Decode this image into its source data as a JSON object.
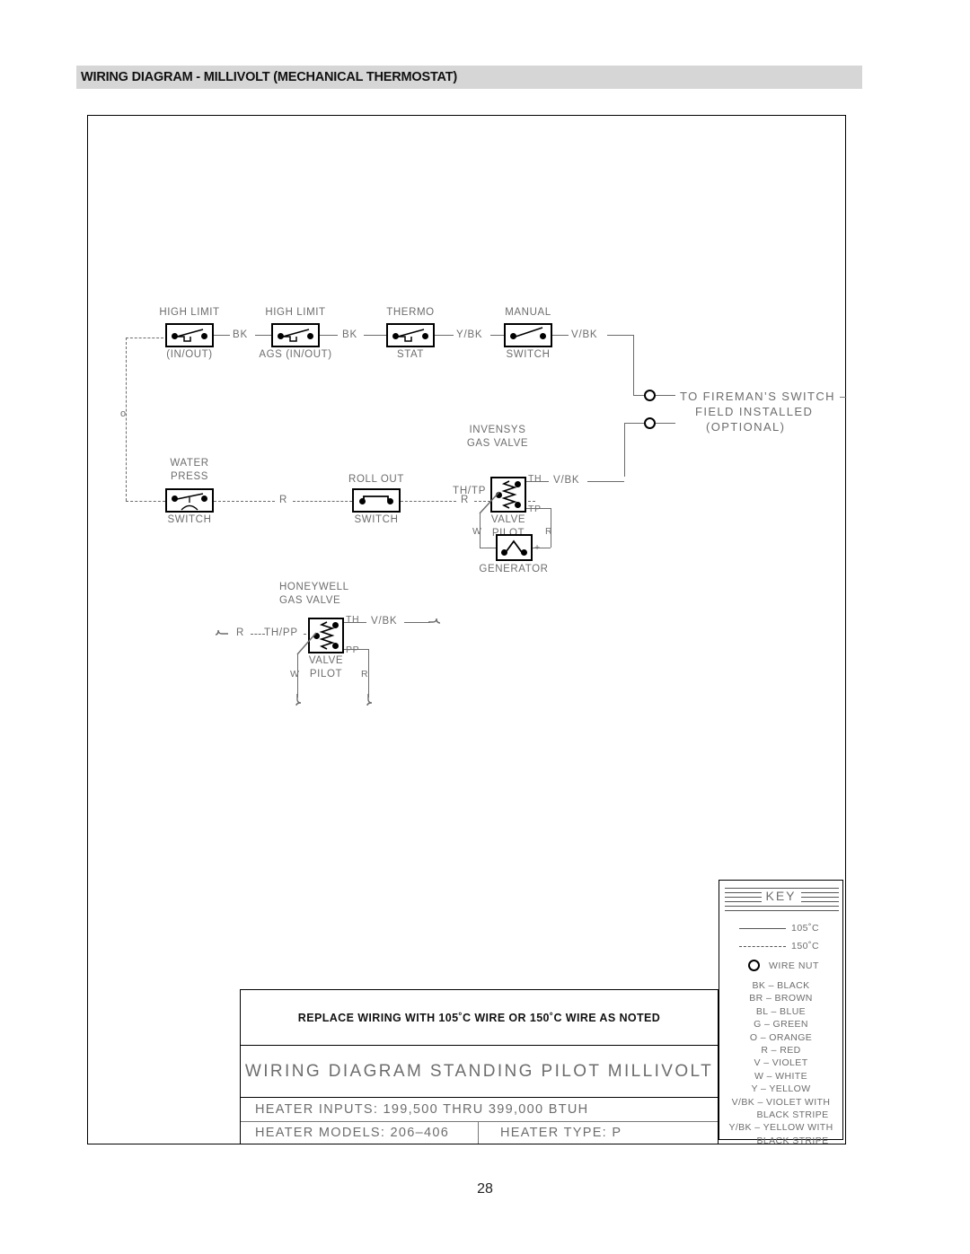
{
  "header": {
    "title": "WIRING DIAGRAM - MILLIVOLT (MECHANICAL THERMOSTAT)"
  },
  "page": {
    "number": "28"
  },
  "diagram": {
    "components": {
      "high_limit_in_out": {
        "top": "HIGH  LIMIT",
        "bottom": "(IN/OUT)"
      },
      "high_limit_ags": {
        "top": "HIGH  LIMIT",
        "bottom": "AGS  (IN/OUT)"
      },
      "thermostat": {
        "top": "THERMO",
        "bottom": "STAT"
      },
      "manual_switch": {
        "top": "MANUAL",
        "bottom": "SWITCH"
      },
      "water_press_switch": {
        "top1": "WATER",
        "top2": "PRESS",
        "bottom": "SWITCH"
      },
      "roll_out_switch": {
        "top": "ROLL  OUT",
        "bottom": "SWITCH"
      },
      "invensys_valve": {
        "title1": "INVENSYS",
        "title2": "GAS  VALVE",
        "body1": "VALVE",
        "body2": "PILOT"
      },
      "honeywell_valve": {
        "title1": "HONEYWELL",
        "title2": "GAS  VALVE",
        "body1": "VALVE",
        "body2": "PILOT"
      },
      "generator": {
        "label": "GENERATOR",
        "minus": "–",
        "plus": "+"
      }
    },
    "wire_labels": {
      "bk_1": "BK",
      "bk_2": "BK",
      "ybk": "Y/BK",
      "vbk_manual": "V/BK",
      "r_1": "R",
      "r_2": "R",
      "th_tp": "TH/TP",
      "th_invensys": "TH",
      "tp_invensys": "TP",
      "vbk_invensys": "V/BK",
      "w_invensys": "W",
      "r_invensys": "R",
      "r_honeywell_in": "R",
      "th_pp": "TH/PP",
      "th_honeywell": "TH",
      "pp_honeywell": "PP",
      "vbk_honeywell": "V/BK",
      "w_honeywell": "W",
      "r_honeywell": "R",
      "o_marker": "o"
    },
    "annotations": {
      "fireman_line1": "TO  FIREMAN’S  SWITCH  –",
      "fireman_line2": "FIELD  INSTALLED",
      "fireman_line3": "(OPTIONAL)"
    }
  },
  "key": {
    "title": "KEY",
    "samples": [
      {
        "style": "solid",
        "label": "105˚C"
      },
      {
        "style": "dashed",
        "label": "150˚C"
      },
      {
        "style": "wirenut",
        "label": "WIRE  NUT"
      }
    ],
    "colors": [
      {
        "code": "BK",
        "name": "BLACK"
      },
      {
        "code": "BR",
        "name": "BROWN"
      },
      {
        "code": "BL",
        "name": "BLUE"
      },
      {
        "code": "G",
        "name": "GREEN"
      },
      {
        "code": "O",
        "name": "ORANGE"
      },
      {
        "code": "R",
        "name": "RED"
      },
      {
        "code": "V",
        "name": "VIOLET"
      },
      {
        "code": "W",
        "name": "WHITE"
      },
      {
        "code": "Y",
        "name": "YELLOW"
      },
      {
        "code": "V/BK",
        "name": "VIOLET  WITH",
        "name2": "BLACK  STRIPE"
      },
      {
        "code": "Y/BK",
        "name": "YELLOW  WITH",
        "name2": "BLACK  STRIPE"
      }
    ]
  },
  "title_block": {
    "notice": "REPLACE  WIRING  WITH  105˚C  WIRE  OR  150˚C  WIRE  AS  NOTED",
    "main": "WIRING  DIAGRAM  STANDING  PILOT  MILLIVOLT",
    "inputs": "HEATER INPUTS:   199,500 THRU 399,000 BTUH",
    "models": "HEATER MODELS:  206–406",
    "type": "HEATER TYPE:   P"
  }
}
